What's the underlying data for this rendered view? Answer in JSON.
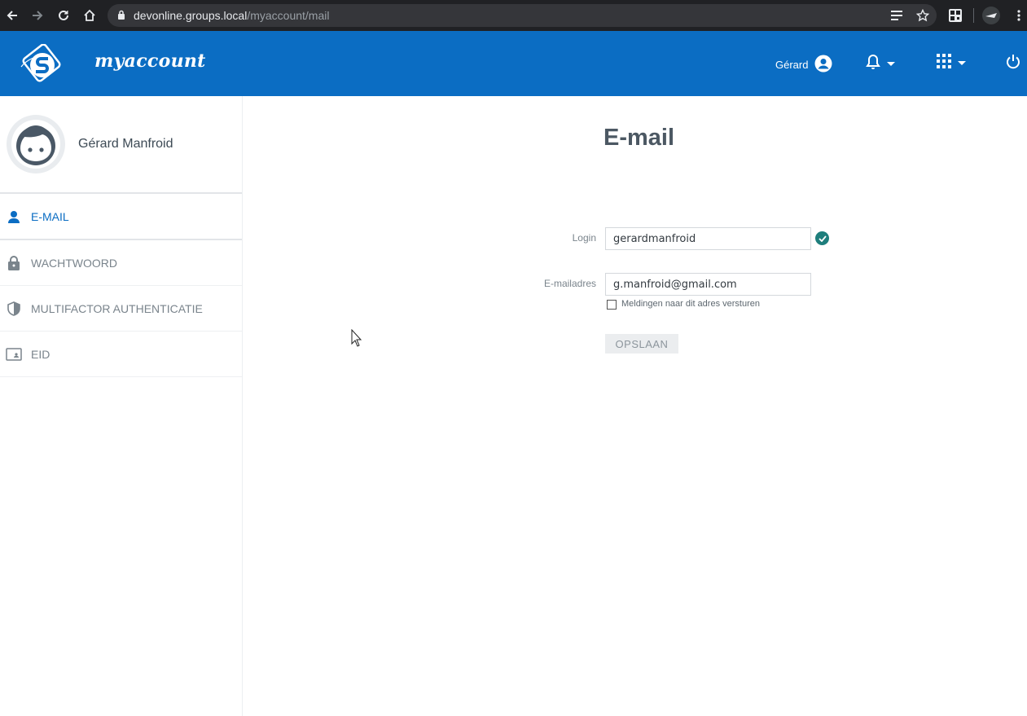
{
  "browser": {
    "url_host": "devonline.groups.local",
    "url_path": "/myaccount/mail"
  },
  "header": {
    "brand": "myaccount",
    "user_name": "Gérard",
    "accent_color": "#0b6dc3"
  },
  "sidebar": {
    "profile_name": "Gérard Manfroid",
    "items": [
      {
        "label": "E-MAIL",
        "icon": "person-icon",
        "active": true
      },
      {
        "label": "WACHTWOORD",
        "icon": "lock-icon",
        "active": false
      },
      {
        "label": "MULTIFACTOR AUTHENTICATIE",
        "icon": "shield-icon",
        "active": false
      },
      {
        "label": "EID",
        "icon": "id-card-icon",
        "active": false
      }
    ]
  },
  "main": {
    "title": "E-mail",
    "login_label": "Login",
    "login_value": "gerardmanfroid",
    "email_label": "E-mailadres",
    "email_value": "g.manfroid@gmail.com",
    "notify_label": "Meldingen naar dit adres versturen",
    "notify_checked": false,
    "save_label": "OPSLAAN"
  }
}
